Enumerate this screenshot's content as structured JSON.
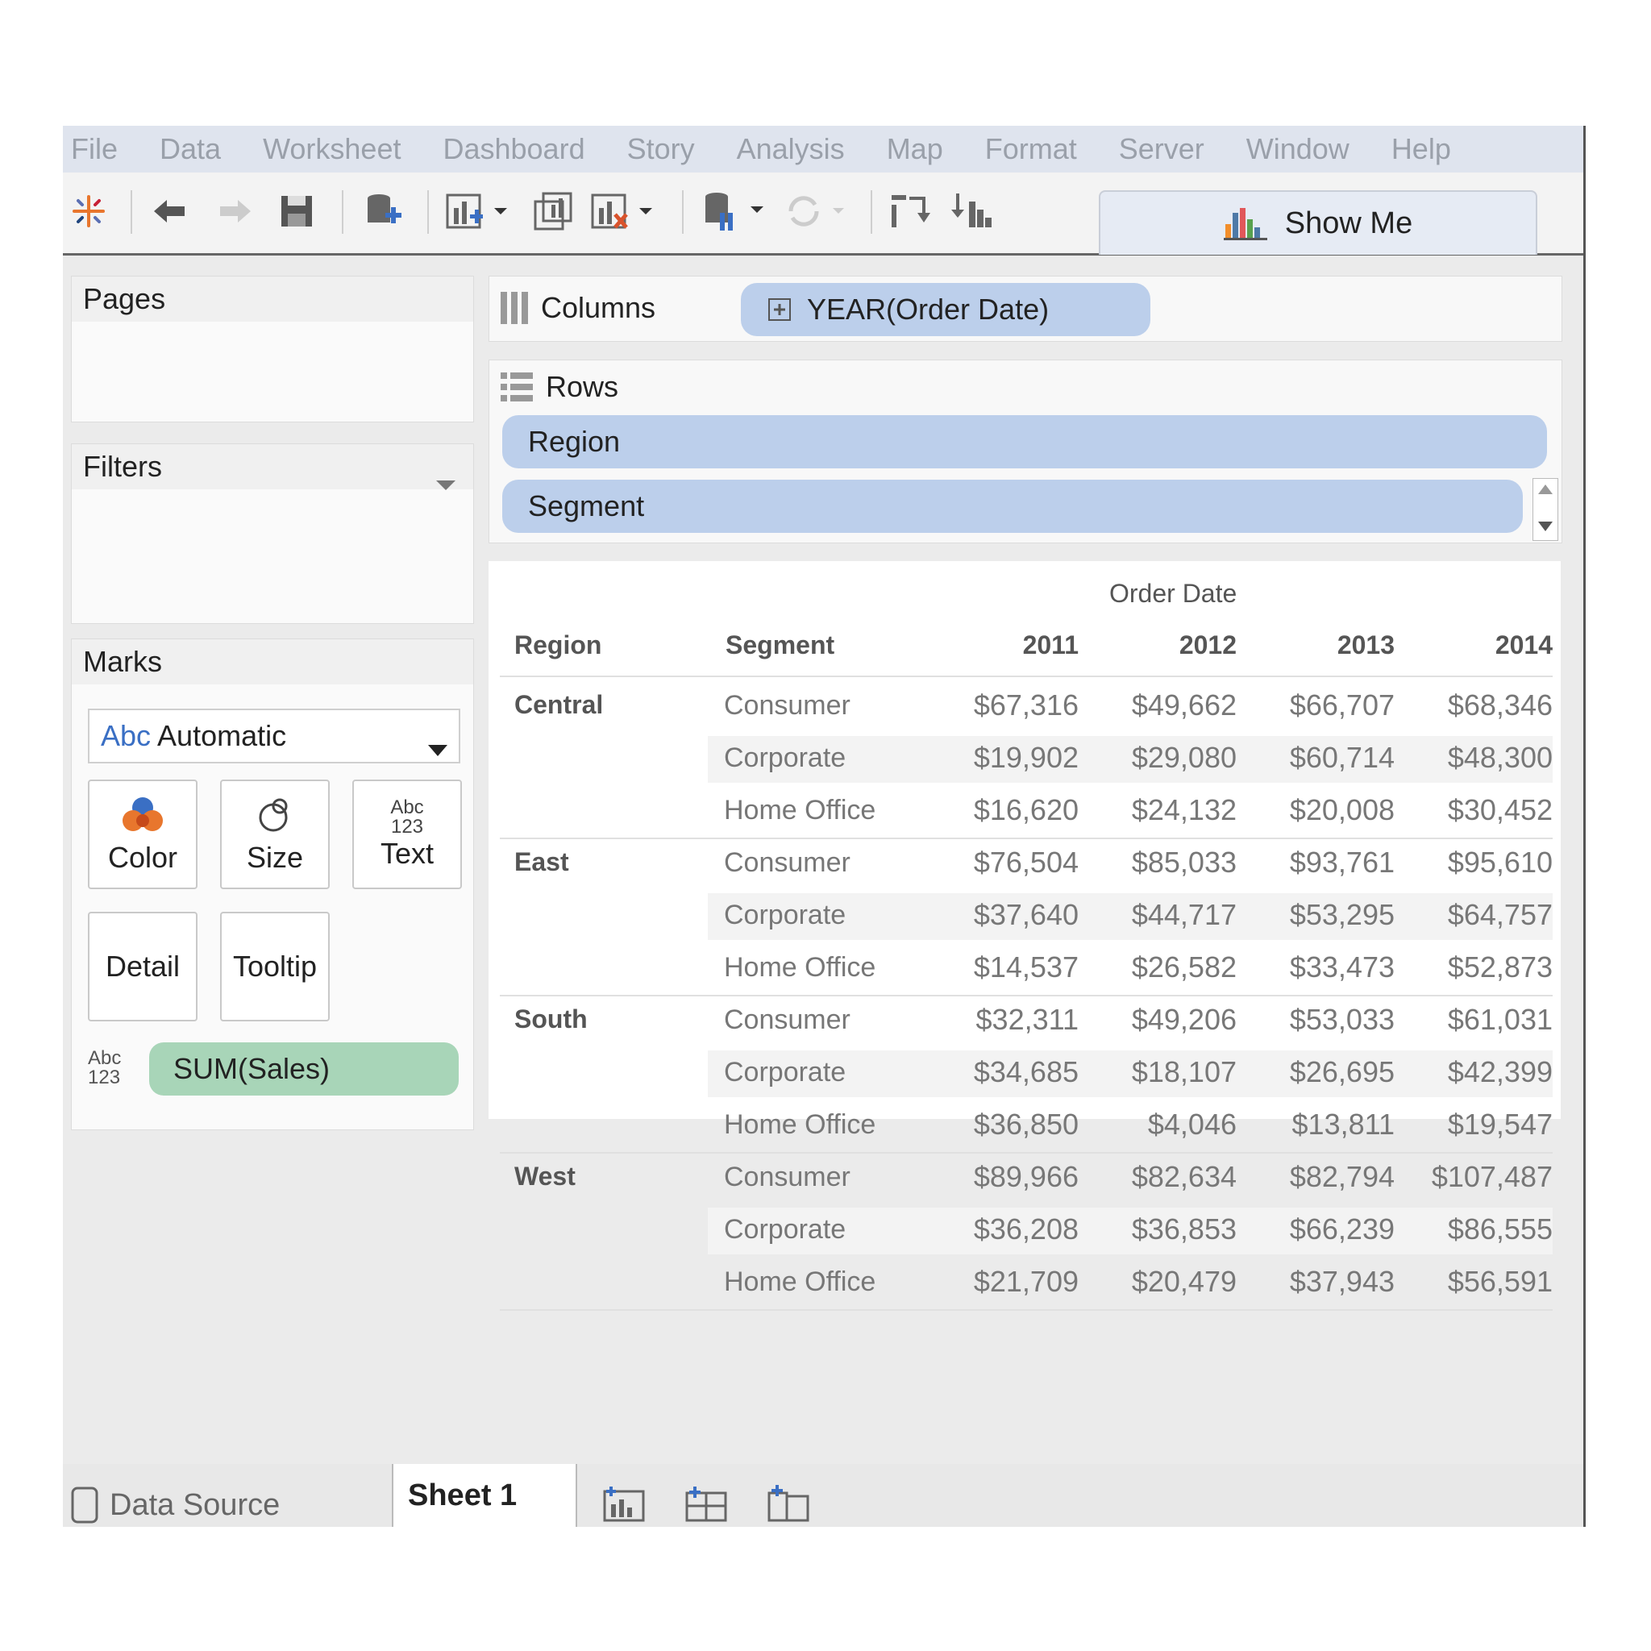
{
  "menu": [
    "File",
    "Data",
    "Worksheet",
    "Dashboard",
    "Story",
    "Analysis",
    "Map",
    "Format",
    "Server",
    "Window",
    "Help"
  ],
  "toolbar": {
    "show_me": "Show Me"
  },
  "panels": {
    "pages": "Pages",
    "filters": "Filters",
    "marks": "Marks"
  },
  "marks": {
    "type_prefix": "Abc",
    "type": "Automatic",
    "cards": [
      "Color",
      "Size",
      "Text",
      "Detail",
      "Tooltip"
    ],
    "text_icon_top": "Abc",
    "text_icon_bottom": "123",
    "field_icon_top": "Abc",
    "field_icon_bottom": "123",
    "field": "SUM(Sales)"
  },
  "shelves": {
    "columns_label": "Columns",
    "columns_pill": "YEAR(Order Date)",
    "rows_label": "Rows",
    "rows_pills": [
      "Region",
      "Segment"
    ]
  },
  "table": {
    "column_group": "Order Date",
    "headers": [
      "Region",
      "Segment",
      "2011",
      "2012",
      "2013",
      "2014"
    ],
    "regions": [
      {
        "name": "Central",
        "rows": [
          {
            "segment": "Consumer",
            "values": [
              "$67,316",
              "$49,662",
              "$66,707",
              "$68,346"
            ]
          },
          {
            "segment": "Corporate",
            "values": [
              "$19,902",
              "$29,080",
              "$60,714",
              "$48,300"
            ]
          },
          {
            "segment": "Home Office",
            "values": [
              "$16,620",
              "$24,132",
              "$20,008",
              "$30,452"
            ]
          }
        ]
      },
      {
        "name": "East",
        "rows": [
          {
            "segment": "Consumer",
            "values": [
              "$76,504",
              "$85,033",
              "$93,761",
              "$95,610"
            ]
          },
          {
            "segment": "Corporate",
            "values": [
              "$37,640",
              "$44,717",
              "$53,295",
              "$64,757"
            ]
          },
          {
            "segment": "Home Office",
            "values": [
              "$14,537",
              "$26,582",
              "$33,473",
              "$52,873"
            ]
          }
        ]
      },
      {
        "name": "South",
        "rows": [
          {
            "segment": "Consumer",
            "values": [
              "$32,311",
              "$49,206",
              "$53,033",
              "$61,031"
            ]
          },
          {
            "segment": "Corporate",
            "values": [
              "$34,685",
              "$18,107",
              "$26,695",
              "$42,399"
            ]
          },
          {
            "segment": "Home Office",
            "values": [
              "$36,850",
              "$4,046",
              "$13,811",
              "$19,547"
            ]
          }
        ]
      },
      {
        "name": "West",
        "rows": [
          {
            "segment": "Consumer",
            "values": [
              "$89,966",
              "$82,634",
              "$82,794",
              "$107,487"
            ]
          },
          {
            "segment": "Corporate",
            "values": [
              "$36,208",
              "$36,853",
              "$66,239",
              "$86,555"
            ]
          },
          {
            "segment": "Home Office",
            "values": [
              "$21,709",
              "$20,479",
              "$37,943",
              "$56,591"
            ]
          }
        ]
      }
    ]
  },
  "tabs": {
    "data_source": "Data Source",
    "sheet": "Sheet 1"
  },
  "colors": {
    "dimension_pill": "#bccfeb",
    "measure_pill": "#a8d5b8",
    "menu_bg": "#dfe4ee"
  },
  "icons": [
    "tableau-logo-icon",
    "undo-icon",
    "redo-icon",
    "save-icon",
    "new-datasource-icon",
    "new-worksheet-icon",
    "duplicate-sheet-icon",
    "clear-sheet-icon",
    "pause-updates-icon",
    "refresh-icon",
    "swap-icon",
    "sort-icon",
    "show-me-chart-icon",
    "new-sheet-icon",
    "new-dashboard-icon",
    "new-story-icon"
  ]
}
